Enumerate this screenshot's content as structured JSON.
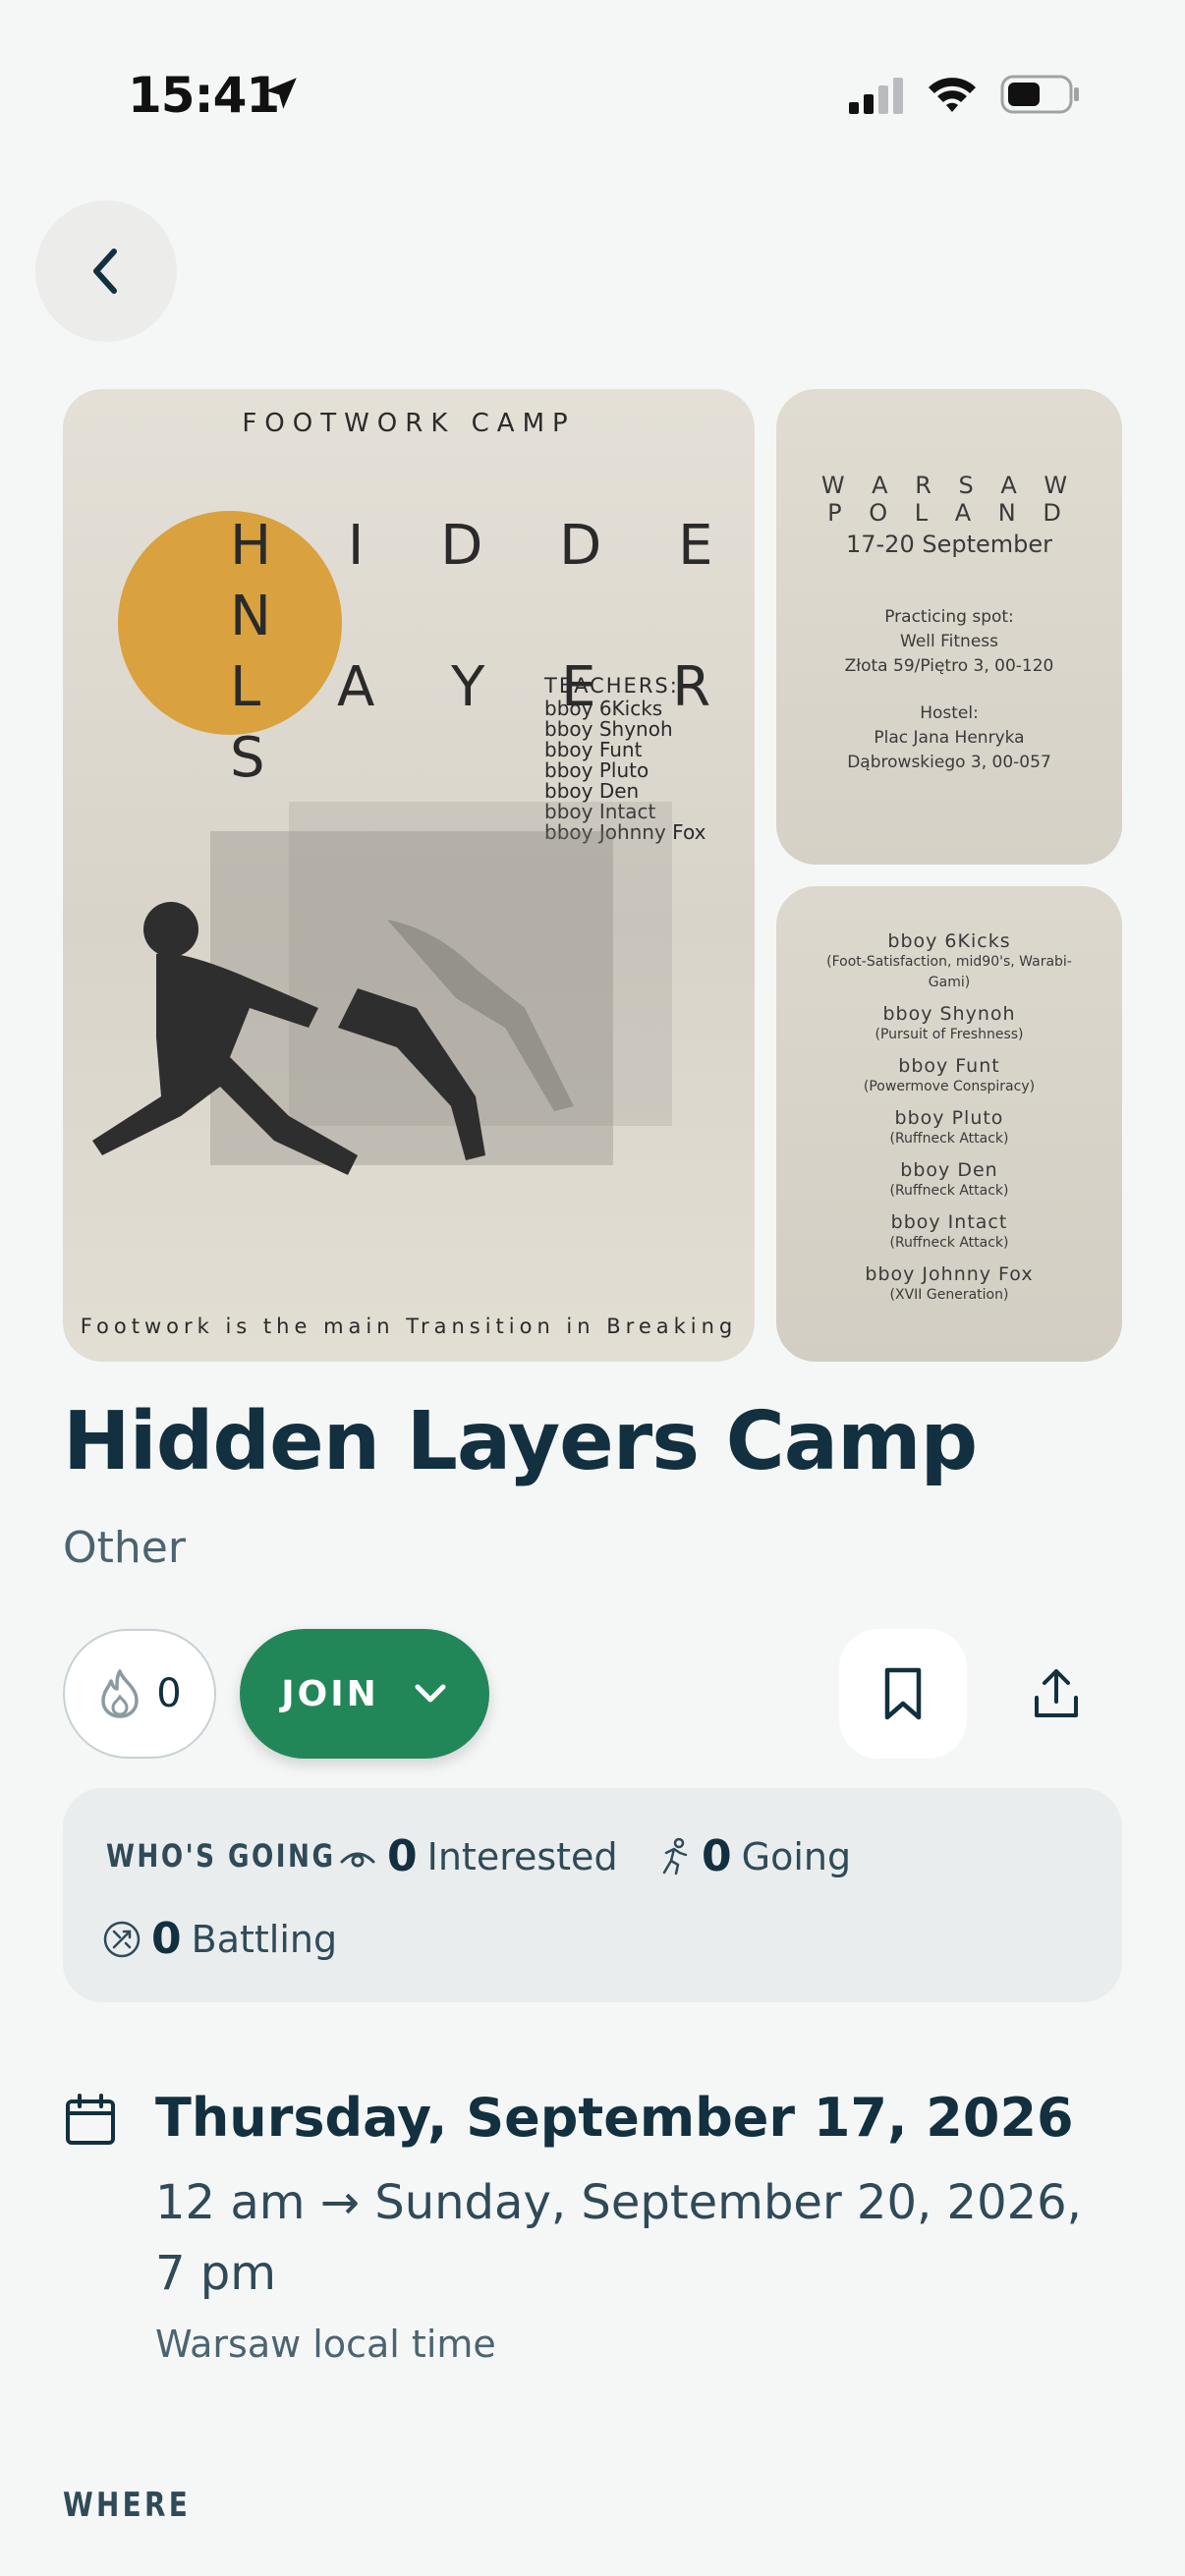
{
  "status_bar": {
    "time": "15:41"
  },
  "posters": {
    "main": {
      "header": "FOOTWORK CAMP",
      "title_line1": "H I D D E N",
      "title_line2": "L A Y E R S",
      "teachers_heading": "TEACHERS:",
      "teachers": [
        "bboy 6Kicks",
        "bboy Shynoh",
        "bboy Funt",
        "bboy Pluto",
        "bboy Den",
        "bboy Intact",
        "bboy Johnny Fox"
      ],
      "footer": "Footwork is the main Transition in Breaking"
    },
    "info": {
      "city": "W A R S A W",
      "country": "P O L A N D",
      "dates": "17-20 September",
      "spot_heading": "Practicing spot:",
      "spot_name": "Well Fitness",
      "spot_address": "Złota 59/Piętro 3, 00-120",
      "hostel_heading": "Hostel:",
      "hostel_line1": "Plac Jana Henryka",
      "hostel_line2": "Dąbrowskiego 3, 00-057"
    },
    "crews": [
      {
        "name": "bboy 6Kicks",
        "crew": "(Foot-Satisfaction, mid90's, Warabi-Gami)"
      },
      {
        "name": "bboy Shynoh",
        "crew": "(Pursuit of Freshness)"
      },
      {
        "name": "bboy Funt",
        "crew": "(Powermove Conspiracy)"
      },
      {
        "name": "bboy Pluto",
        "crew": "(Ruffneck Attack)"
      },
      {
        "name": "bboy Den",
        "crew": "(Ruffneck Attack)"
      },
      {
        "name": "bboy Intact",
        "crew": "(Ruffneck Attack)"
      },
      {
        "name": "bboy Johnny Fox",
        "crew": "(XVII Generation)"
      }
    ]
  },
  "event": {
    "title": "Hidden Layers Camp",
    "category": "Other"
  },
  "actions": {
    "fire_count": "0",
    "join_label": "JOIN"
  },
  "whos_going": {
    "label": "WHO'S GOING",
    "interested_count": "0",
    "interested_label": "Interested",
    "going_count": "0",
    "going_label": "Going",
    "battling_count": "0",
    "battling_label": "Battling"
  },
  "when": {
    "start": "Thursday, September 17, 2026",
    "range": "12 am  →  Sunday, September 20, 2026, 7 pm",
    "timezone": "Warsaw local time"
  },
  "where": {
    "label": "WHERE"
  },
  "colors": {
    "accent_green": "#228758",
    "title_navy": "#12303f",
    "poster_sun": "#d9a23e"
  }
}
